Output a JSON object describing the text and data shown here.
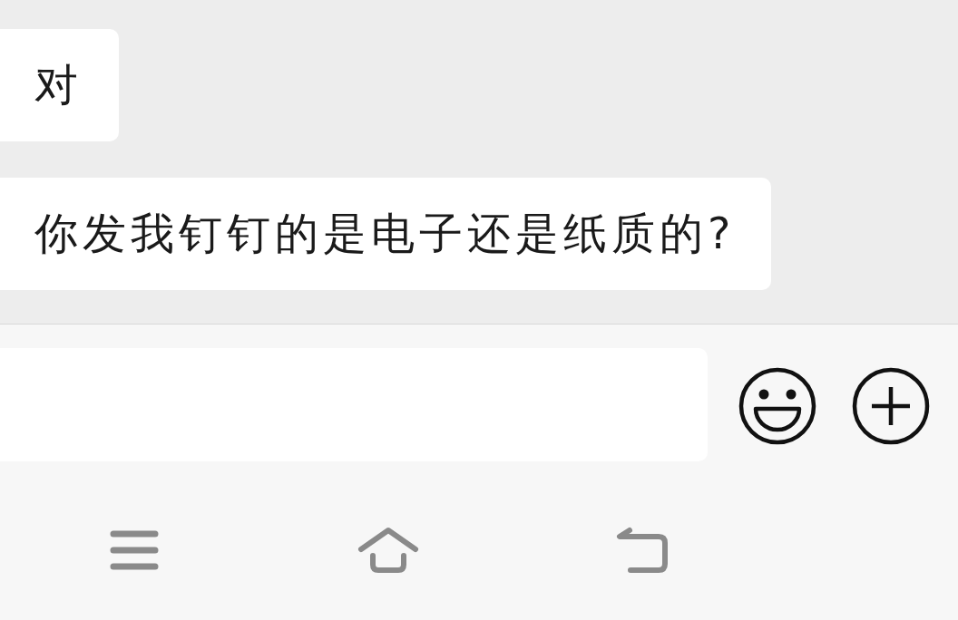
{
  "messages": [
    {
      "text": "对"
    },
    {
      "text": "你发我钉钉的是电子还是纸质的?"
    }
  ]
}
